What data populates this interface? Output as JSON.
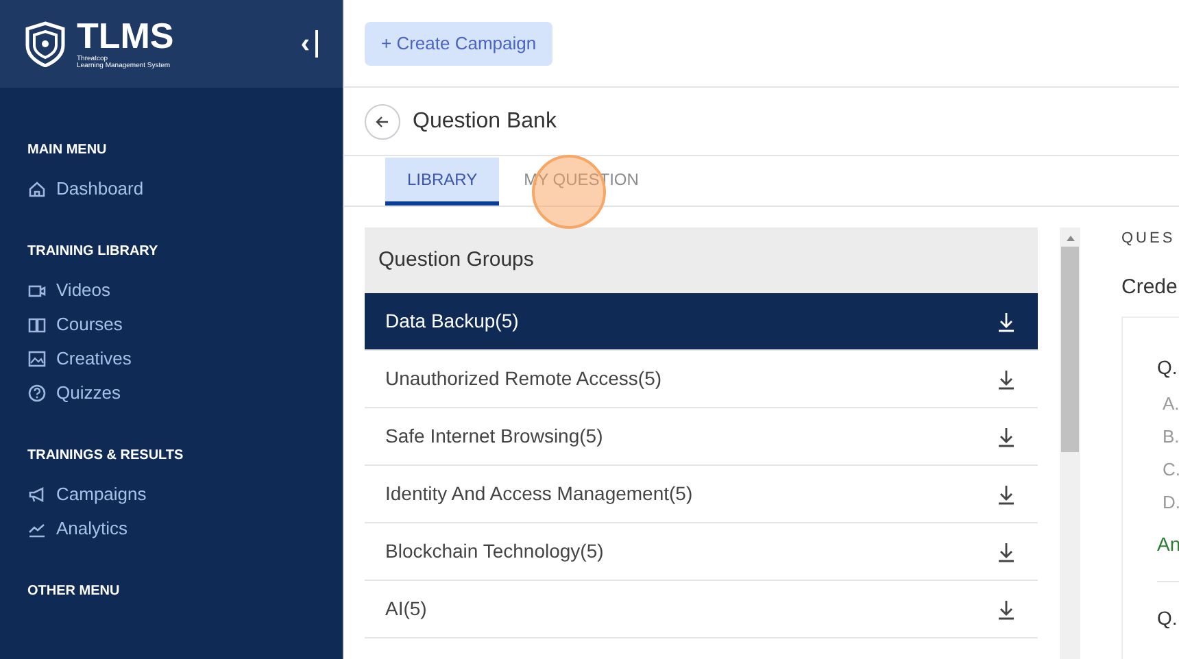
{
  "sidebar": {
    "logo": {
      "title": "TLMS",
      "subtitle_1": "Threatcop",
      "subtitle_2": "Learning Management System"
    },
    "collapse": "‹",
    "sections": [
      {
        "heading": "MAIN MENU",
        "items": [
          {
            "label": "Dashboard",
            "kind": "home"
          }
        ]
      },
      {
        "heading": "TRAINING LIBRARY",
        "items": [
          {
            "label": "Videos",
            "kind": "video"
          },
          {
            "label": "Courses",
            "kind": "book"
          },
          {
            "label": "Creatives",
            "kind": "image"
          },
          {
            "label": "Quizzes",
            "kind": "help"
          }
        ]
      },
      {
        "heading": "TRAININGS & RESULTS",
        "items": [
          {
            "label": "Campaigns",
            "kind": "megaphone"
          },
          {
            "label": "Analytics",
            "kind": "chart"
          }
        ]
      },
      {
        "heading": "OTHER MENU"
      }
    ]
  },
  "create_button": "+ Create Campaign",
  "page_title": "Question Bank",
  "tabs": [
    {
      "label": "LIBRARY",
      "selected": true
    },
    {
      "label": "MY QUESTION",
      "selected": false
    }
  ],
  "groups": {
    "heading": "Question Groups",
    "items": [
      {
        "label": "Data Backup(5)",
        "selected": true
      },
      {
        "label": "Unauthorized Remote Access(5)",
        "selected": false
      },
      {
        "label": "Safe Internet Browsing(5)",
        "selected": false
      },
      {
        "label": "Identity And Access Management(5)",
        "selected": false
      },
      {
        "label": "Blockchain Technology(5)",
        "selected": false
      },
      {
        "label": "AI(5)",
        "selected": false
      }
    ]
  },
  "preview": {
    "heading": "QUES",
    "title": "Crede",
    "questions": [
      {
        "number": "Q.",
        "options": [
          "A.",
          "B.",
          "C.",
          "D."
        ],
        "answer": "An"
      },
      {
        "number": "Q."
      }
    ]
  }
}
